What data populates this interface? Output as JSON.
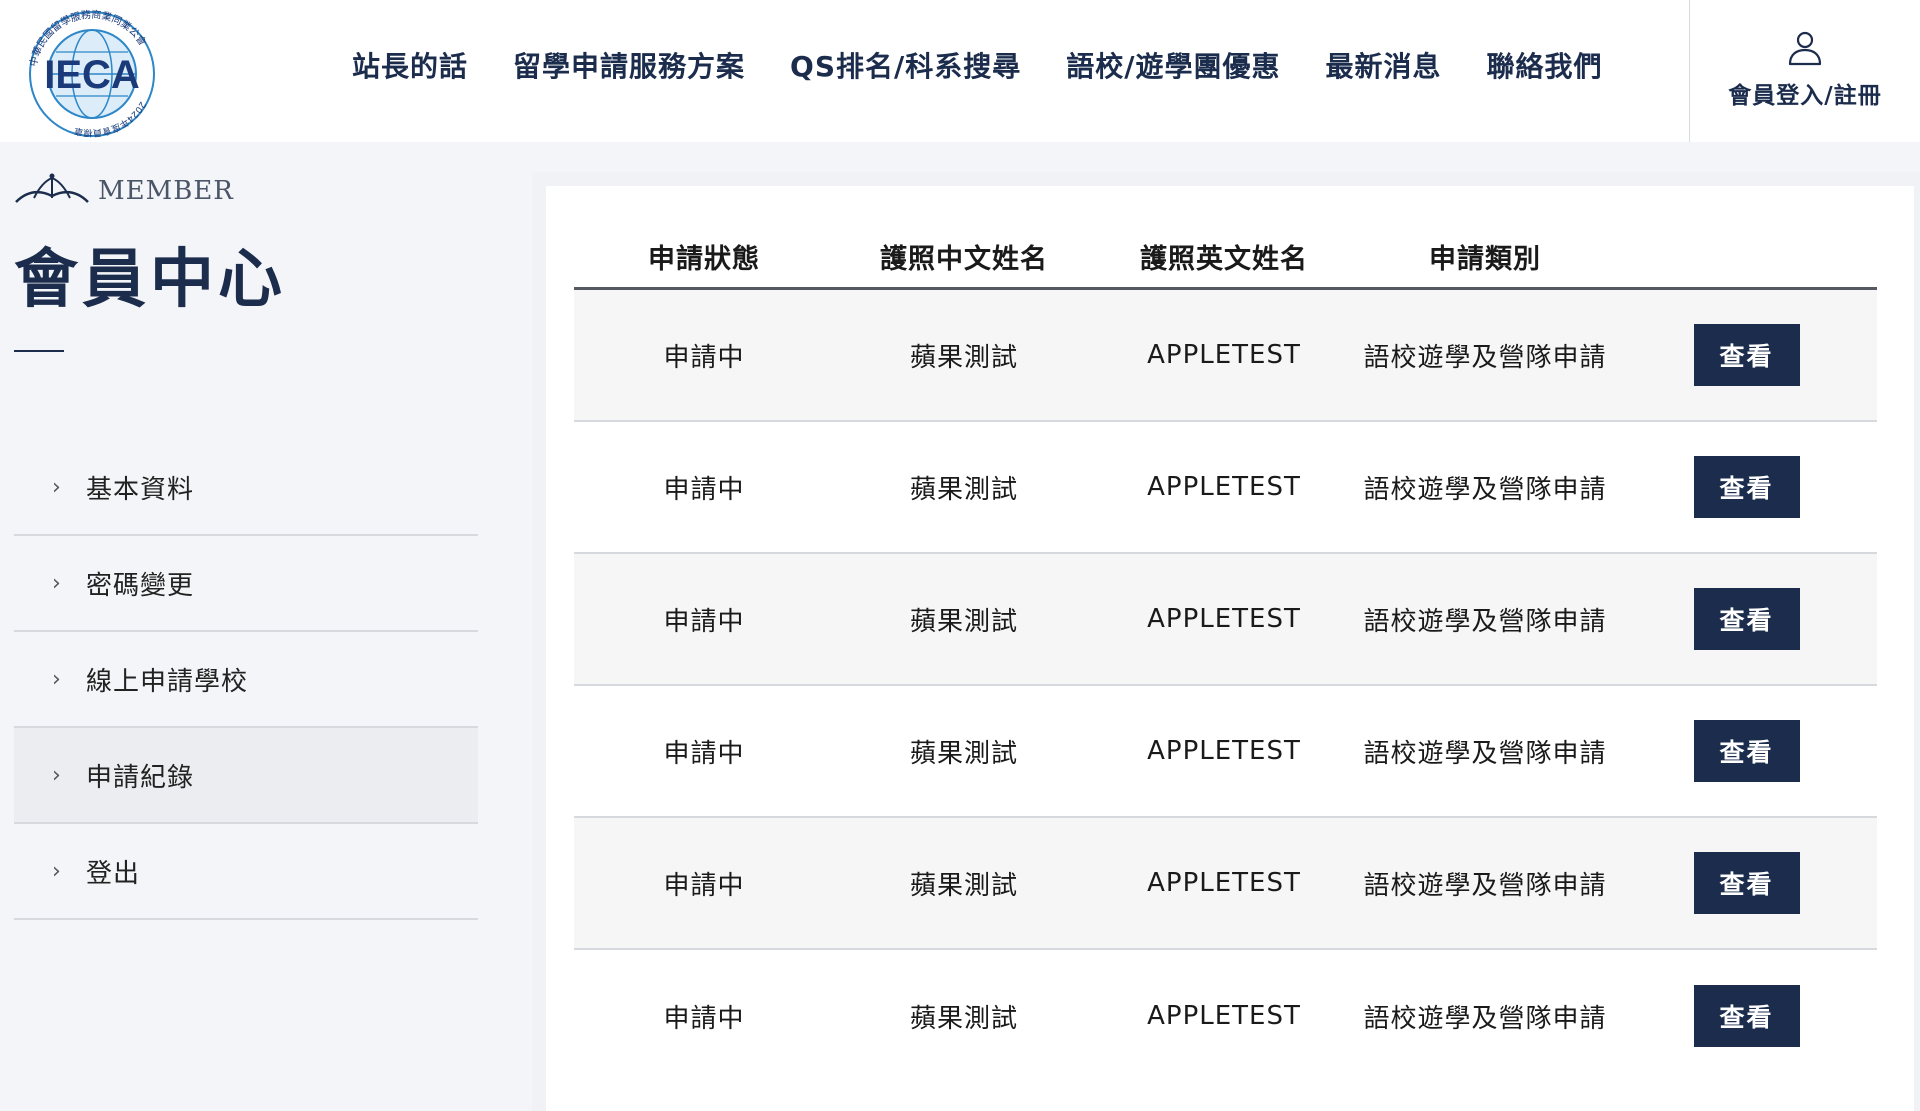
{
  "header": {
    "logo": {
      "icon": "ieca-globe-logo",
      "text": "IECA",
      "ring_text": "中華民國留學服務商業同業公會",
      "badge_text": "2024年度會員標章",
      "colors": {
        "globe": "#2d87c8",
        "text": "#1a3a7a",
        "accent": "#e3b02c"
      }
    },
    "nav": [
      {
        "label": "站長的話"
      },
      {
        "label": "留學申請服務方案"
      },
      {
        "label": "QS排名/科系搜尋"
      },
      {
        "label": "語校/遊學團優惠"
      },
      {
        "label": "最新消息"
      },
      {
        "label": "聯絡我們"
      }
    ],
    "login": {
      "icon": "user-icon",
      "label": "會員登入/註冊"
    }
  },
  "sidebar": {
    "tag": "MEMBER",
    "tag_icon": "crown-icon",
    "title": "會員中心",
    "items": [
      {
        "label": "基本資料",
        "active": false
      },
      {
        "label": "密碼變更",
        "active": false
      },
      {
        "label": "線上申請學校",
        "active": false
      },
      {
        "label": "申請紀錄",
        "active": true
      },
      {
        "label": "登出",
        "active": false
      }
    ]
  },
  "table": {
    "headers": [
      "申請狀態",
      "護照中文姓名",
      "護照英文姓名",
      "申請類別",
      ""
    ],
    "action_label": "查看",
    "rows": [
      {
        "status": "申請中",
        "name_zh": "蘋果測試",
        "name_en": "APPLETEST",
        "category": "語校遊學及營隊申請"
      },
      {
        "status": "申請中",
        "name_zh": "蘋果測試",
        "name_en": "APPLETEST",
        "category": "語校遊學及營隊申請"
      },
      {
        "status": "申請中",
        "name_zh": "蘋果測試",
        "name_en": "APPLETEST",
        "category": "語校遊學及營隊申請"
      },
      {
        "status": "申請中",
        "name_zh": "蘋果測試",
        "name_en": "APPLETEST",
        "category": "語校遊學及營隊申請"
      },
      {
        "status": "申請中",
        "name_zh": "蘋果測試",
        "name_en": "APPLETEST",
        "category": "語校遊學及營隊申請"
      },
      {
        "status": "申請中",
        "name_zh": "蘋果測試",
        "name_en": "APPLETEST",
        "category": "語校遊學及營隊申請"
      }
    ]
  },
  "colors": {
    "brand_navy": "#1b2c4c",
    "page_bg": "#f3f5f8",
    "row_alt": "#f6f6f6",
    "divider": "#d6d9de"
  }
}
